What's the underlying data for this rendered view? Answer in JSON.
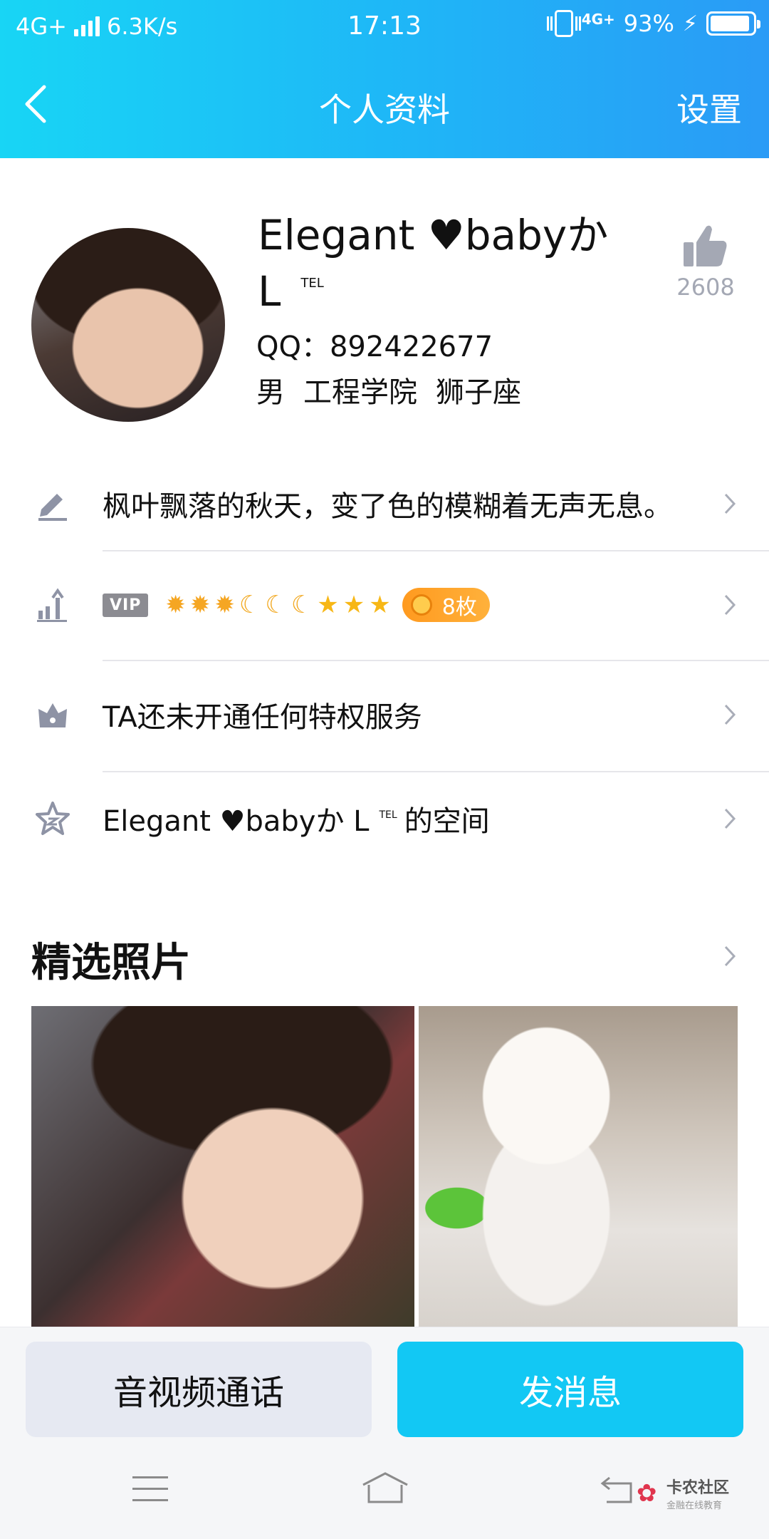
{
  "status_bar": {
    "network": "4G+",
    "speed": "6.3K/s",
    "time": "17:13",
    "net_small": "4G+",
    "battery": "93%",
    "battery_level": 0.93
  },
  "nav": {
    "title": "个人资料",
    "settings": "设置"
  },
  "profile": {
    "name": "Elegant ♥babyか L",
    "name_suffix": "TEL",
    "qq_label": "QQ：",
    "qq_number": "892422677",
    "gender": "男",
    "school": "工程学院",
    "zodiac": "狮子座",
    "like_count": "2608"
  },
  "rows": {
    "signature": "枫叶飘落的秋天，变了色的模糊着无声无息。",
    "vip_label": "VIP",
    "level_icons": [
      "sun",
      "sun",
      "sun",
      "moon",
      "moon",
      "moon",
      "star",
      "star",
      "star"
    ],
    "badge_count": "8枚",
    "privilege": "TA还未开通任何特权服务",
    "space_name": "Elegant ♥babyか L",
    "space_suffix": "TEL",
    "space_tail": "的空间"
  },
  "photos": {
    "title": "精选照片"
  },
  "actions": {
    "call": "音视频通话",
    "message": "发消息"
  },
  "watermark": {
    "name": "卡农社区",
    "tagline": "金融在线教育"
  },
  "colors": {
    "header_start": "#18d5f5",
    "header_end": "#2a9bf6",
    "primary_button": "#12c8f4",
    "secondary_button": "#e6e9f2",
    "badge_pill": "#ff9a1f",
    "icon_gray": "#a4a8b4"
  }
}
